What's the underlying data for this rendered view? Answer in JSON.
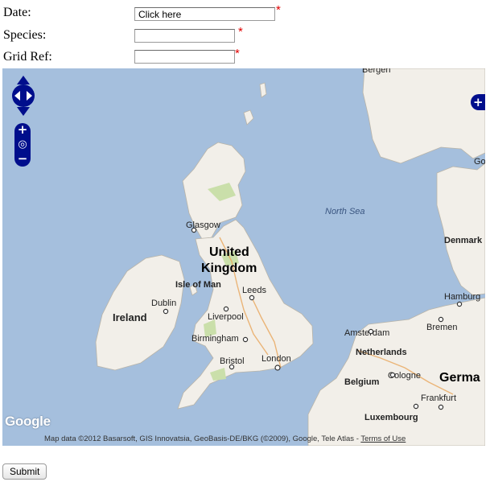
{
  "form": {
    "date_label": "Date:",
    "date_value": "Click here",
    "species_label": "Species:",
    "species_value": "",
    "gridref_label": "Grid Ref:",
    "gridref_value": "",
    "required_marker": "*",
    "submit_label": "Submit"
  },
  "map": {
    "labels": {
      "bergen": "Bergen",
      "north_sea": "North Sea",
      "glasgow": "Glasgow",
      "uk_line1": "United",
      "uk_line2": "Kingdom",
      "isle_of_man": "Isle of Man",
      "dublin": "Dublin",
      "ireland": "Ireland",
      "leeds": "Leeds",
      "liverpool": "Liverpool",
      "birmingham": "Birmingham",
      "bristol": "Bristol",
      "london": "London",
      "denmark": "Denmark",
      "hamburg": "Hamburg",
      "bremen": "Bremen",
      "amsterdam": "Amsterdam",
      "netherlands": "Netherlands",
      "belgium": "Belgium",
      "cologne": "Cologne",
      "germany": "Germa",
      "frankfurt": "Frankfurt",
      "luxembourg": "Luxembourg",
      "go": "Go"
    },
    "attribution_text": "Map data ©2012 Basarsoft, GIS Innovatsia, GeoBasis-DE/BKG (©2009), Google, Tele Atlas - ",
    "terms_link": "Terms of Use",
    "logo_text": "Google",
    "colors": {
      "water": "#a5bfdd",
      "land": "#f2efe9",
      "park": "#cadfaa",
      "controls": "#000e8c",
      "required": "#e00000"
    }
  }
}
